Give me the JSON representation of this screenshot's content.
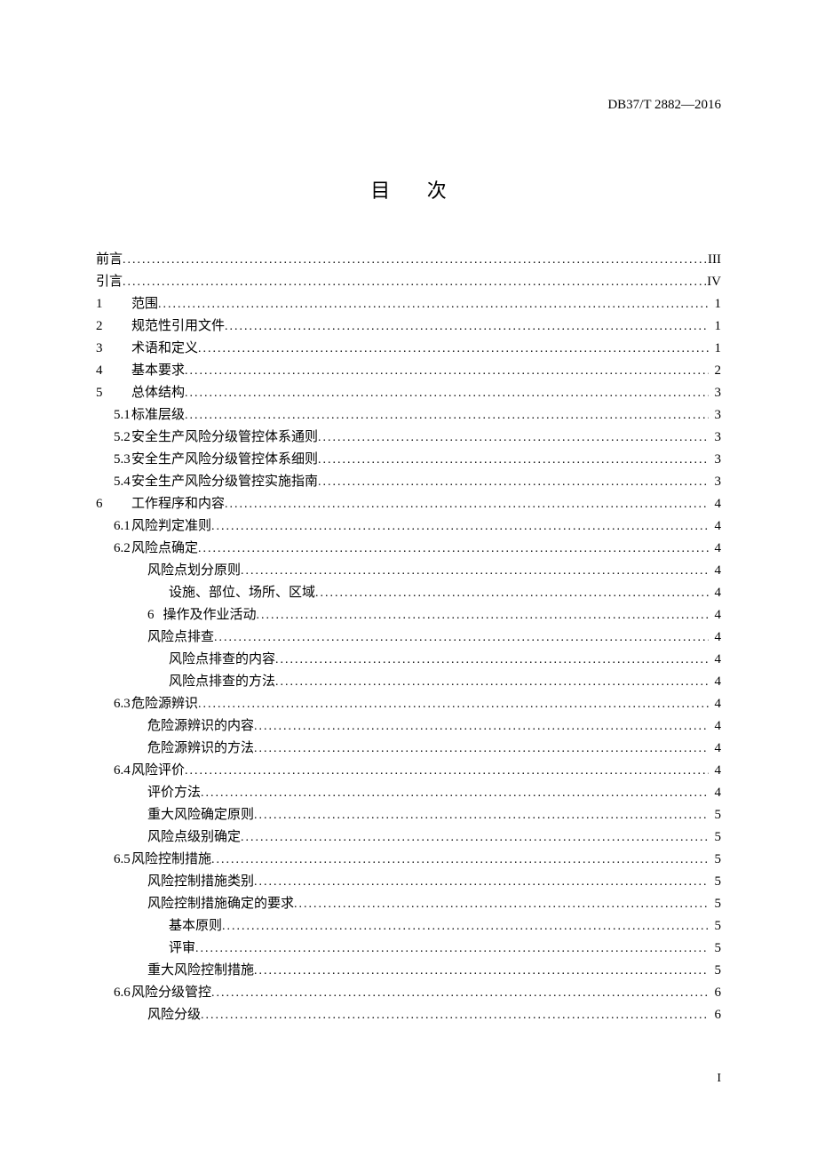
{
  "standard_code": "DB37/T 2882—2016",
  "title": "目  次",
  "footer_page": "I",
  "toc": [
    {
      "level": 0,
      "number": "",
      "label": "前言",
      "page": "III"
    },
    {
      "level": 0,
      "number": "",
      "label": "引言",
      "page": "IV"
    },
    {
      "level": 0,
      "number": "1",
      "label": "范围",
      "page": "1"
    },
    {
      "level": 0,
      "number": "2",
      "label": "规范性引用文件",
      "page": "1"
    },
    {
      "level": 0,
      "number": "3",
      "label": "术语和定义",
      "page": "1"
    },
    {
      "level": 0,
      "number": "4",
      "label": "基本要求",
      "page": "2"
    },
    {
      "level": 0,
      "number": "5",
      "label": "总体结构",
      "page": "3"
    },
    {
      "level": 1,
      "number": "5.1",
      "label": "标准层级",
      "page": "3"
    },
    {
      "level": 1,
      "number": "5.2",
      "label": "安全生产风险分级管控体系通则",
      "page": "3"
    },
    {
      "level": 1,
      "number": "5.3",
      "label": "安全生产风险分级管控体系细则",
      "page": "3"
    },
    {
      "level": 1,
      "number": "5.4",
      "label": "安全生产风险分级管控实施指南",
      "page": "3"
    },
    {
      "level": 0,
      "number": "6",
      "label": "工作程序和内容",
      "page": "4"
    },
    {
      "level": 1,
      "number": "6.1",
      "label": "风险判定准则",
      "page": "4"
    },
    {
      "level": 1,
      "number": "6.2",
      "label": "风险点确定",
      "page": "4"
    },
    {
      "level": 2,
      "number": "",
      "label": "风险点划分原则",
      "page": "4"
    },
    {
      "level": 3,
      "number": "",
      "label": "设施、部位、场所、区域",
      "page": "4"
    },
    {
      "level": 2,
      "number": "6 ",
      "label": "操作及作业活动",
      "page": "4"
    },
    {
      "level": 2,
      "number": "",
      "label": "风险点排查",
      "page": "4"
    },
    {
      "level": 3,
      "number": "",
      "label": "风险点排查的内容",
      "page": "4"
    },
    {
      "level": 3,
      "number": "",
      "label": "风险点排查的方法",
      "page": "4"
    },
    {
      "level": 1,
      "number": "6.3",
      "label": "危险源辨识",
      "page": "4"
    },
    {
      "level": 2,
      "number": "",
      "label": "危险源辨识的内容",
      "page": "4"
    },
    {
      "level": 2,
      "number": "",
      "label": "危险源辨识的方法",
      "page": "4"
    },
    {
      "level": 1,
      "number": "6.4",
      "label": "风险评价",
      "page": "4"
    },
    {
      "level": 2,
      "number": "",
      "label": "评价方法",
      "page": "4"
    },
    {
      "level": 2,
      "number": "",
      "label": "重大风险确定原则",
      "page": "5"
    },
    {
      "level": 2,
      "number": "",
      "label": "风险点级别确定",
      "page": "5"
    },
    {
      "level": 1,
      "number": "6.5",
      "label": "风险控制措施",
      "page": "5"
    },
    {
      "level": 2,
      "number": "",
      "label": "风险控制措施类别",
      "page": "5"
    },
    {
      "level": 2,
      "number": "",
      "label": "风险控制措施确定的要求",
      "page": "5"
    },
    {
      "level": 3,
      "number": "",
      "label": "基本原则",
      "page": "5"
    },
    {
      "level": 3,
      "number": "",
      "label": "评审",
      "page": "5"
    },
    {
      "level": 2,
      "number": "",
      "label": "重大风险控制措施",
      "page": "5"
    },
    {
      "level": 1,
      "number": "6.6",
      "label": "风险分级管控",
      "page": "6"
    },
    {
      "level": 2,
      "number": "",
      "label": "风险分级",
      "page": "6"
    }
  ]
}
